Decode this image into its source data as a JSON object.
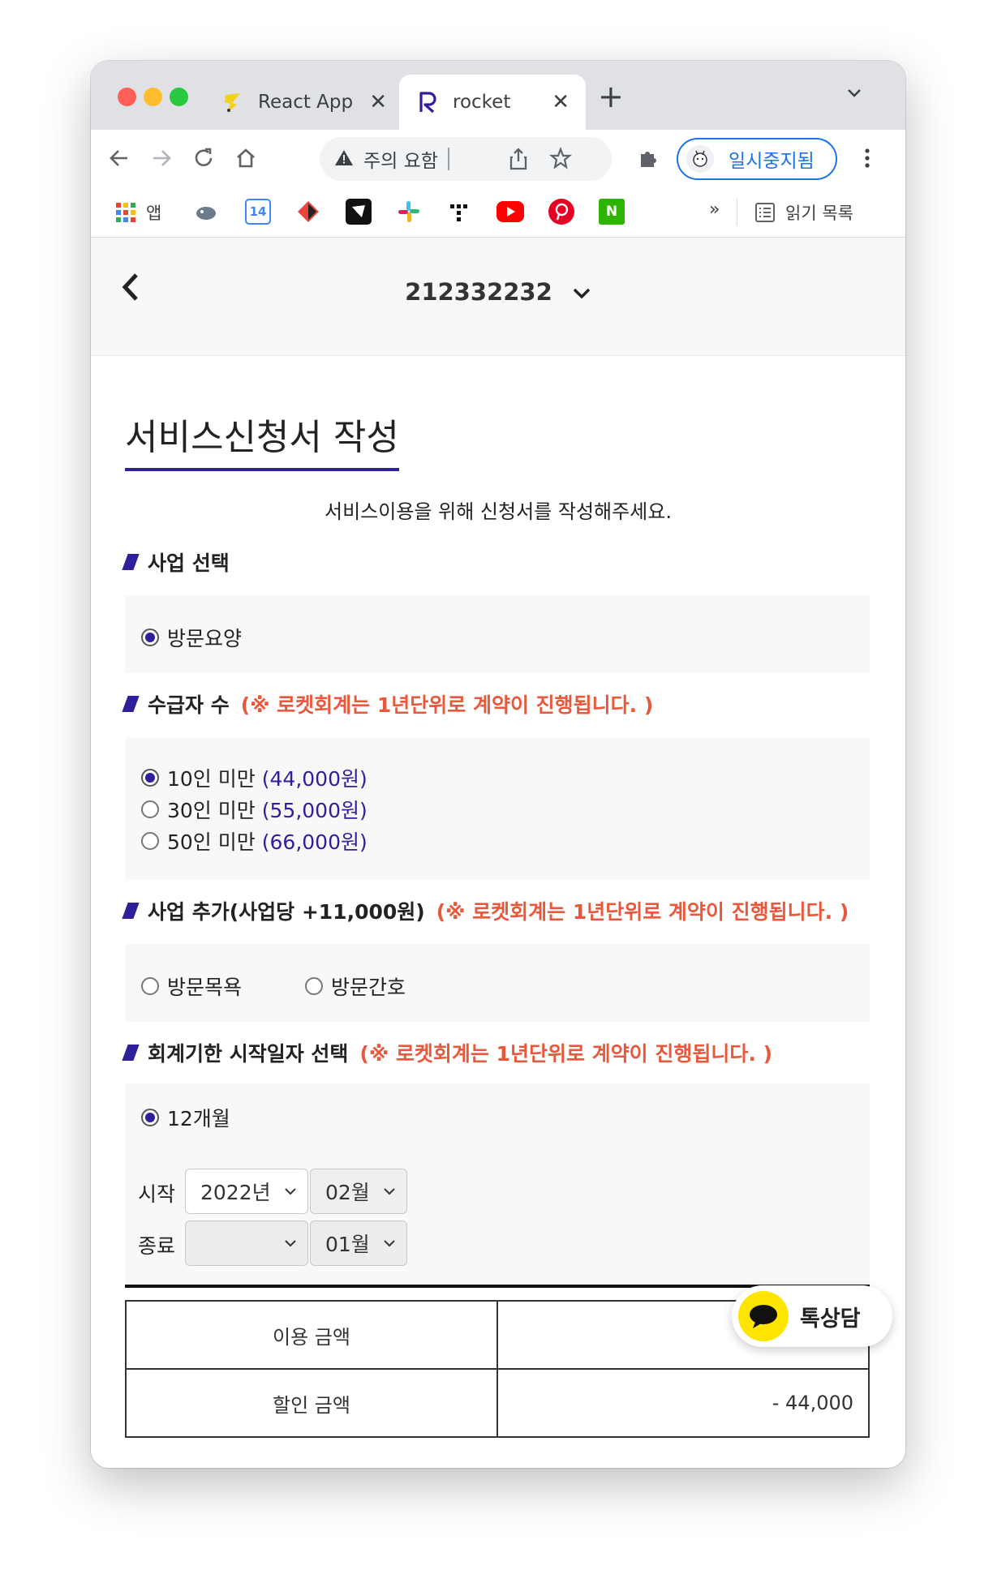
{
  "browser": {
    "tabs": [
      {
        "label": "React App",
        "favicon": "react-app-favicon"
      },
      {
        "label": "rocket",
        "favicon": "rocket-r-favicon",
        "active": true
      }
    ],
    "new_tab": "+",
    "omnibox": {
      "security_label": "주의 요함"
    },
    "profile_label": "일시중지됨",
    "bookmarks": {
      "apps_label": "앱",
      "items": [
        "globe-bird-icon",
        "google-calendar-icon",
        "git-icon",
        "notion-like-icon",
        "slack-icon",
        "tidal-icon",
        "youtube-icon",
        "pinterest-icon",
        "naver-icon"
      ],
      "calendar_day": "14",
      "overflow": "»",
      "reading_list_label": "읽기 목록"
    }
  },
  "header": {
    "account_number": "212332232"
  },
  "page": {
    "title": "서비스신청서 작성",
    "subtitle": "서비스이용을 위해 신청서를 작성해주세요."
  },
  "sections": {
    "business": {
      "title": "사업 선택",
      "options": [
        {
          "label": "방문요양",
          "checked": true
        }
      ]
    },
    "recipients": {
      "title": "수급자 수",
      "note": "(※ 로켓회계는 1년단위로 계약이 진행됩니다. )",
      "options": [
        {
          "label": "10인 미만",
          "price": "(44,000원)",
          "checked": true
        },
        {
          "label": "30인 미만",
          "price": "(55,000원)",
          "checked": false
        },
        {
          "label": "50인 미만",
          "price": "(66,000원)",
          "checked": false
        }
      ]
    },
    "addon": {
      "title": "사업 추가(사업당 +11,000원)",
      "note": "(※ 로켓회계는 1년단위로 계약이 진행됩니다. )",
      "options": [
        {
          "label": "방문목욕",
          "checked": false
        },
        {
          "label": "방문간호",
          "checked": false
        }
      ]
    },
    "period": {
      "title": "회계기한 시작일자 선택",
      "note": "(※ 로켓회계는 1년단위로 계약이 진행됩니다. )",
      "options": [
        {
          "label": "12개월",
          "checked": true
        }
      ],
      "start_label": "시작",
      "start_year": "2022년",
      "start_month": "02월",
      "end_label": "종료",
      "end_year": "",
      "end_month": "01월"
    }
  },
  "summary": {
    "rows": [
      {
        "label": "이용 금액",
        "value": ""
      },
      {
        "label": "할인 금액",
        "value": "- 44,000"
      }
    ]
  },
  "chat": {
    "label": "톡상담"
  },
  "colors": {
    "accent": "#2e1f9a",
    "note": "#e8583c",
    "kakao": "#fee500"
  }
}
